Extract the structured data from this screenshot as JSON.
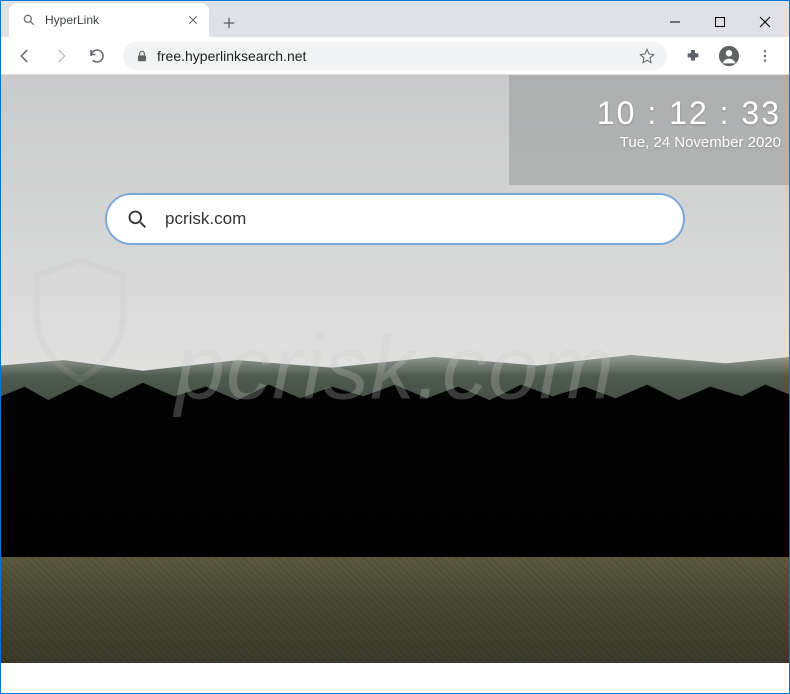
{
  "window": {
    "tab_title": "HyperLink",
    "url_display": "free.hyperlinksearch.net"
  },
  "page": {
    "clock_time": "10 : 12 : 33",
    "clock_date": "Tue, 24 November 2020",
    "search_value": "pcrisk.com"
  },
  "watermark": {
    "text": "pcrisk.com"
  }
}
